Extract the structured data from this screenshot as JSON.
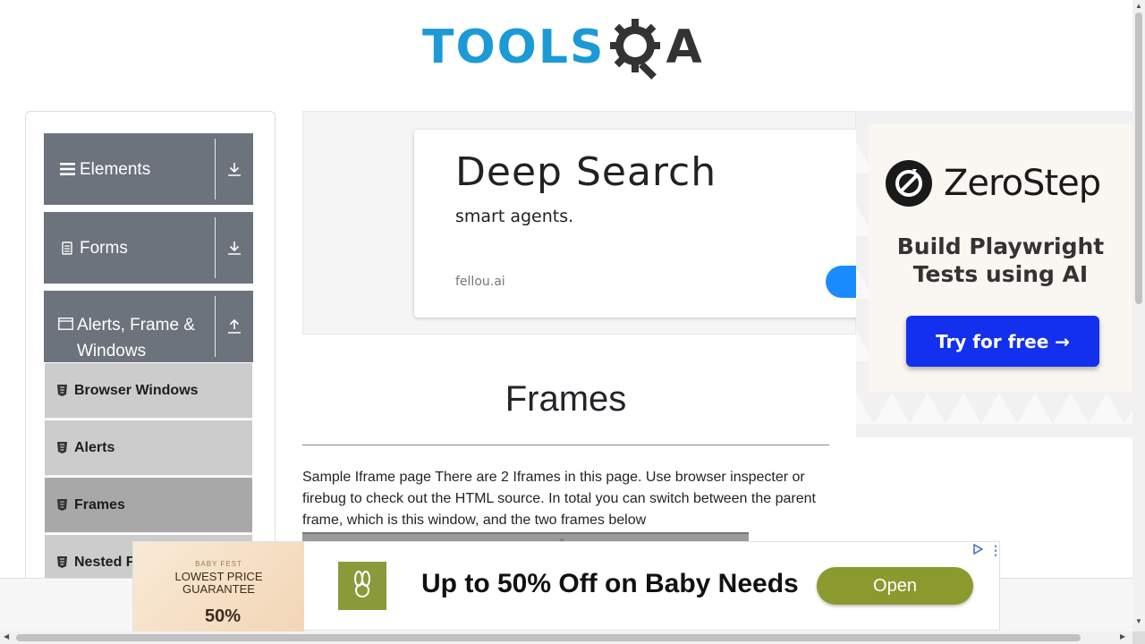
{
  "logo": {
    "text": "TOOLS",
    "suffix": "A"
  },
  "sidebar": {
    "groups": [
      {
        "label": "Elements",
        "icon": "hamburger-icon",
        "toggle_icon": "download-arrow-icon"
      },
      {
        "label": "Forms",
        "icon": "document-icon",
        "toggle_icon": "download-arrow-icon"
      },
      {
        "label": "Alerts, Frame & Windows",
        "icon": "window-icon",
        "toggle_icon": "upload-arrow-icon"
      }
    ],
    "items": [
      {
        "label": "Browser Windows",
        "icon": "html5-icon"
      },
      {
        "label": "Alerts",
        "icon": "html5-icon"
      },
      {
        "label": "Frames",
        "icon": "html5-icon",
        "active": true
      },
      {
        "label": "Nested Frames",
        "icon": "html5-icon"
      }
    ]
  },
  "top_ad": {
    "title": "Deep Search",
    "subtitle": "smart agents.",
    "domain": "fellou.ai",
    "button_color": "#1a8cff"
  },
  "right_ad": {
    "brand": "ZeroStep",
    "headline": "Build Playwright Tests using AI",
    "cta": "Try for free →",
    "cta_color": "#1330ee"
  },
  "main": {
    "title": "Frames",
    "description": "Sample Iframe page There are 2 Iframes in this page. Use browser inspecter or firebug to check out the HTML source. In total you can switch between the parent frame, which is this window, and the two frames below"
  },
  "bottom_ad": {
    "image_event": "BABY FEST",
    "image_line1": "LOWEST PRICE",
    "image_line2": "GUARANTEE",
    "image_discount": "50%",
    "logo_text": "R for Rabbit",
    "headline": "Up to 50% Off on Baby Needs",
    "button": "Open",
    "button_color": "#8b9a2e"
  },
  "colors": {
    "logo_blue": "#1b9ad6",
    "sidebar_group": "#6c737c",
    "sidebar_item": "#cccccc",
    "sidebar_item_active": "#a8a8a8"
  }
}
